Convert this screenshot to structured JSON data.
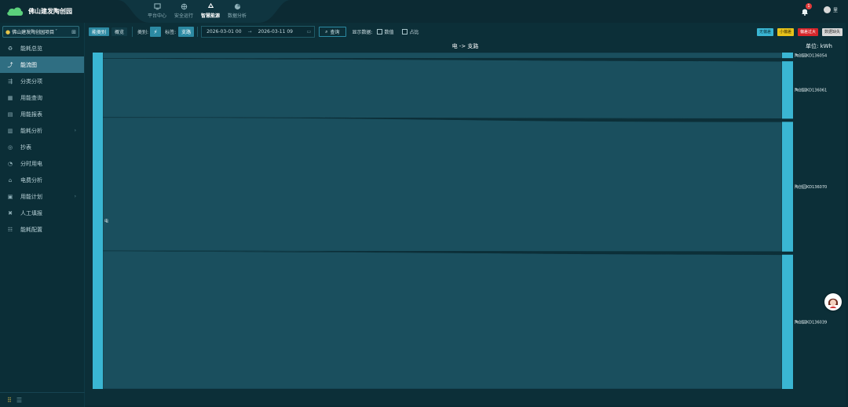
{
  "app": {
    "title": "佛山建发陶创园"
  },
  "topnav": [
    {
      "label": "平台中心",
      "icon": "platform-icon",
      "active": false
    },
    {
      "label": "安全运行",
      "icon": "safety-icon",
      "active": false
    },
    {
      "label": "智慧能源",
      "icon": "recycle-icon",
      "active": true
    },
    {
      "label": "数据分析",
      "icon": "pie-chart-icon",
      "active": false
    }
  ],
  "header": {
    "badge_count": "1",
    "user_name": "里"
  },
  "sidebar": {
    "project": "佛山建发陶创园项目",
    "items": [
      {
        "label": "能耗总览",
        "icon": "recycle-icon"
      },
      {
        "label": "能流图",
        "icon": "flow-icon"
      },
      {
        "label": "分类分项",
        "icon": "category-icon"
      },
      {
        "label": "用能查询",
        "icon": "table-icon"
      },
      {
        "label": "用能报表",
        "icon": "report-icon"
      },
      {
        "label": "能耗分析",
        "icon": "calendar-icon",
        "chevron": "›"
      },
      {
        "label": "抄表",
        "icon": "meter-icon"
      },
      {
        "label": "分时用电",
        "icon": "clock-icon"
      },
      {
        "label": "电费分析",
        "icon": "bill-icon"
      },
      {
        "label": "用能计划",
        "icon": "plan-icon",
        "chevron": "›"
      },
      {
        "label": "人工填报",
        "icon": "wrench-icon"
      },
      {
        "label": "能耗配置",
        "icon": "config-icon"
      }
    ]
  },
  "toolbar": {
    "tab_active": "能类别",
    "tab_other": "概览",
    "category_label": "类别:",
    "tag_label": "标签:",
    "tag_value": "支路",
    "date_start": "2026-03-01 00",
    "date_end": "2026-03-11 09",
    "query_label": "查询",
    "display_label": "显示数据:",
    "opt_value": "数值",
    "opt_ratio": "占比",
    "legend": [
      {
        "label": "无偏差",
        "color": "#3ab6d3",
        "text": "#0b2e37"
      },
      {
        "label": "小偏差",
        "color": "#e8c21a",
        "text": "#3a2d00"
      },
      {
        "label": "偏差过大",
        "color": "#d6262b",
        "text": "#ffffff"
      },
      {
        "label": "数据缺失",
        "color": "#d9d9d9",
        "text": "#333333"
      }
    ]
  },
  "chart": {
    "title": "电 -> 支路",
    "unit": "单位: kWh"
  },
  "chart_data": {
    "type": "sankey",
    "source": {
      "label": "电"
    },
    "targets": [
      {
        "label": "陶创园KD136054",
        "value": 2.1
      },
      {
        "label": "陶创园KD136061",
        "value": 21.5
      },
      {
        "label": "陶创园KD136070",
        "value": 48.6
      },
      {
        "label": "陶创园KD136039",
        "value": 50.3
      }
    ]
  }
}
